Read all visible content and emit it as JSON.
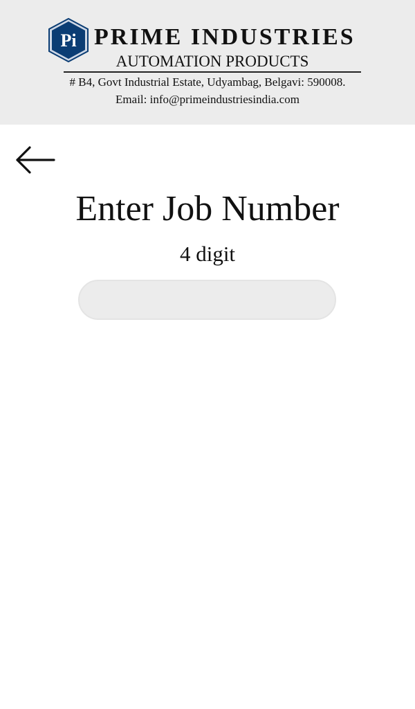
{
  "header": {
    "logo_text": "Pi",
    "company_name": "PRIME INDUSTRIES",
    "company_sub": "AUTOMATION PRODUCTS",
    "address": "# B4, Govt Industrial Estate, Udyambag, Belgavi: 590008.",
    "email": "Email: info@primeindustriesindia.com"
  },
  "colors": {
    "header_bg": "#ececec",
    "logo_fill": "#0b3d74",
    "input_bg": "#ececec"
  },
  "icons": {
    "back": "arrow-left-icon",
    "logo": "pi-hexagon-logo-icon"
  },
  "main": {
    "title": "Enter Job Number",
    "subtitle": "4 digit",
    "job_input": {
      "value": "",
      "placeholder": ""
    }
  }
}
